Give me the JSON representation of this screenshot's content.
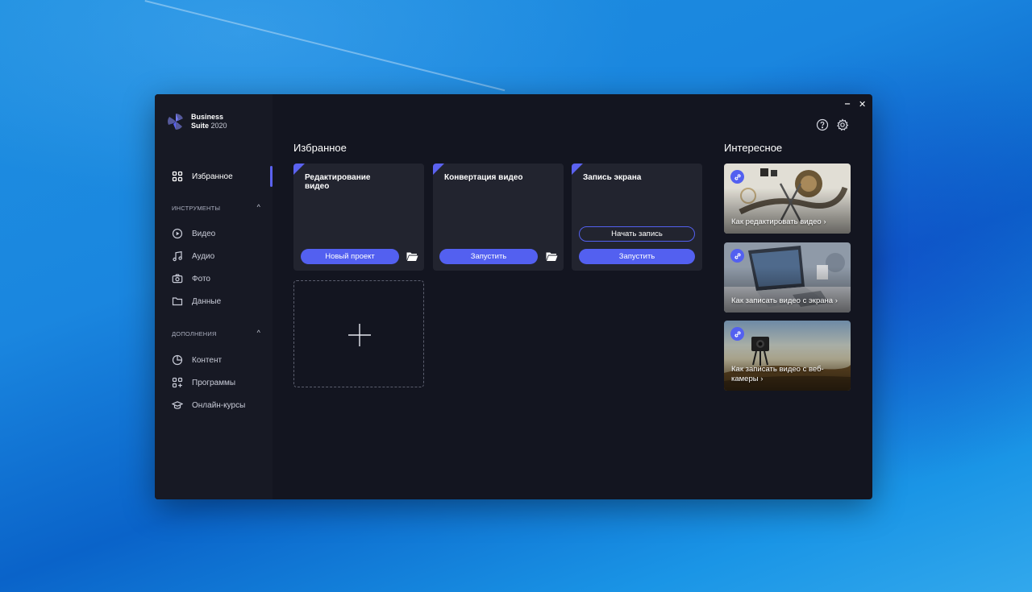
{
  "app": {
    "name": "Business",
    "name_line2": "Suite",
    "year": "2020",
    "minimize": "‒",
    "close": "✕"
  },
  "sidebar": {
    "favorites": "Избранное",
    "tools_header": "ИНСТРУМЕНТЫ",
    "tools": [
      {
        "label": "Видео",
        "icon": "play-circle-icon"
      },
      {
        "label": "Аудио",
        "icon": "music-note-icon"
      },
      {
        "label": "Фото",
        "icon": "camera-icon"
      },
      {
        "label": "Данные",
        "icon": "folder-icon"
      }
    ],
    "addons_header": "ДОПОЛНЕНИЯ",
    "addons": [
      {
        "label": "Контент",
        "icon": "pie-chart-icon"
      },
      {
        "label": "Программы",
        "icon": "apps-add-icon"
      },
      {
        "label": "Онлайн-курсы",
        "icon": "graduation-cap-icon"
      }
    ],
    "chevron": "^"
  },
  "main": {
    "favorites_title": "Избранное",
    "cards": [
      {
        "title": "Редактирование видео",
        "primary": "Новый проект"
      },
      {
        "title": "Конвертация видео",
        "primary": "Запустить"
      },
      {
        "title": "Запись экрана",
        "secondary": "Начать запись",
        "primary": "Запустить"
      }
    ]
  },
  "interesting": {
    "title": "Интересное",
    "items": [
      {
        "label": "Как редактировать видео ›"
      },
      {
        "label": "Как записать видео с экрана ›"
      },
      {
        "label": "Как записать видео с веб-камеры ›"
      }
    ]
  },
  "colors": {
    "accent": "#5360f0",
    "window_bg": "#131520",
    "sidebar_bg": "#171924",
    "card_bg": "#22242f"
  }
}
